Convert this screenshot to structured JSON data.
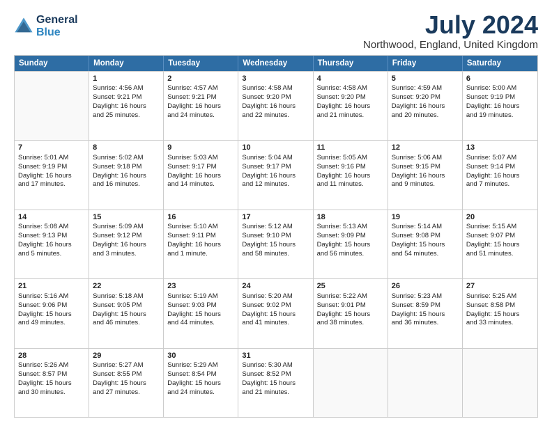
{
  "logo": {
    "line1": "General",
    "line2": "Blue"
  },
  "title": "July 2024",
  "subtitle": "Northwood, England, United Kingdom",
  "days": [
    "Sunday",
    "Monday",
    "Tuesday",
    "Wednesday",
    "Thursday",
    "Friday",
    "Saturday"
  ],
  "weeks": [
    [
      {
        "day": "",
        "sunrise": "",
        "sunset": "",
        "daylight": ""
      },
      {
        "day": "1",
        "sunrise": "Sunrise: 4:56 AM",
        "sunset": "Sunset: 9:21 PM",
        "daylight": "Daylight: 16 hours",
        "daylight2": "and 25 minutes."
      },
      {
        "day": "2",
        "sunrise": "Sunrise: 4:57 AM",
        "sunset": "Sunset: 9:21 PM",
        "daylight": "Daylight: 16 hours",
        "daylight2": "and 24 minutes."
      },
      {
        "day": "3",
        "sunrise": "Sunrise: 4:58 AM",
        "sunset": "Sunset: 9:20 PM",
        "daylight": "Daylight: 16 hours",
        "daylight2": "and 22 minutes."
      },
      {
        "day": "4",
        "sunrise": "Sunrise: 4:58 AM",
        "sunset": "Sunset: 9:20 PM",
        "daylight": "Daylight: 16 hours",
        "daylight2": "and 21 minutes."
      },
      {
        "day": "5",
        "sunrise": "Sunrise: 4:59 AM",
        "sunset": "Sunset: 9:20 PM",
        "daylight": "Daylight: 16 hours",
        "daylight2": "and 20 minutes."
      },
      {
        "day": "6",
        "sunrise": "Sunrise: 5:00 AM",
        "sunset": "Sunset: 9:19 PM",
        "daylight": "Daylight: 16 hours",
        "daylight2": "and 19 minutes."
      }
    ],
    [
      {
        "day": "7",
        "sunrise": "Sunrise: 5:01 AM",
        "sunset": "Sunset: 9:19 PM",
        "daylight": "Daylight: 16 hours",
        "daylight2": "and 17 minutes."
      },
      {
        "day": "8",
        "sunrise": "Sunrise: 5:02 AM",
        "sunset": "Sunset: 9:18 PM",
        "daylight": "Daylight: 16 hours",
        "daylight2": "and 16 minutes."
      },
      {
        "day": "9",
        "sunrise": "Sunrise: 5:03 AM",
        "sunset": "Sunset: 9:17 PM",
        "daylight": "Daylight: 16 hours",
        "daylight2": "and 14 minutes."
      },
      {
        "day": "10",
        "sunrise": "Sunrise: 5:04 AM",
        "sunset": "Sunset: 9:17 PM",
        "daylight": "Daylight: 16 hours",
        "daylight2": "and 12 minutes."
      },
      {
        "day": "11",
        "sunrise": "Sunrise: 5:05 AM",
        "sunset": "Sunset: 9:16 PM",
        "daylight": "Daylight: 16 hours",
        "daylight2": "and 11 minutes."
      },
      {
        "day": "12",
        "sunrise": "Sunrise: 5:06 AM",
        "sunset": "Sunset: 9:15 PM",
        "daylight": "Daylight: 16 hours",
        "daylight2": "and 9 minutes."
      },
      {
        "day": "13",
        "sunrise": "Sunrise: 5:07 AM",
        "sunset": "Sunset: 9:14 PM",
        "daylight": "Daylight: 16 hours",
        "daylight2": "and 7 minutes."
      }
    ],
    [
      {
        "day": "14",
        "sunrise": "Sunrise: 5:08 AM",
        "sunset": "Sunset: 9:13 PM",
        "daylight": "Daylight: 16 hours",
        "daylight2": "and 5 minutes."
      },
      {
        "day": "15",
        "sunrise": "Sunrise: 5:09 AM",
        "sunset": "Sunset: 9:12 PM",
        "daylight": "Daylight: 16 hours",
        "daylight2": "and 3 minutes."
      },
      {
        "day": "16",
        "sunrise": "Sunrise: 5:10 AM",
        "sunset": "Sunset: 9:11 PM",
        "daylight": "Daylight: 16 hours",
        "daylight2": "and 1 minute."
      },
      {
        "day": "17",
        "sunrise": "Sunrise: 5:12 AM",
        "sunset": "Sunset: 9:10 PM",
        "daylight": "Daylight: 15 hours",
        "daylight2": "and 58 minutes."
      },
      {
        "day": "18",
        "sunrise": "Sunrise: 5:13 AM",
        "sunset": "Sunset: 9:09 PM",
        "daylight": "Daylight: 15 hours",
        "daylight2": "and 56 minutes."
      },
      {
        "day": "19",
        "sunrise": "Sunrise: 5:14 AM",
        "sunset": "Sunset: 9:08 PM",
        "daylight": "Daylight: 15 hours",
        "daylight2": "and 54 minutes."
      },
      {
        "day": "20",
        "sunrise": "Sunrise: 5:15 AM",
        "sunset": "Sunset: 9:07 PM",
        "daylight": "Daylight: 15 hours",
        "daylight2": "and 51 minutes."
      }
    ],
    [
      {
        "day": "21",
        "sunrise": "Sunrise: 5:16 AM",
        "sunset": "Sunset: 9:06 PM",
        "daylight": "Daylight: 15 hours",
        "daylight2": "and 49 minutes."
      },
      {
        "day": "22",
        "sunrise": "Sunrise: 5:18 AM",
        "sunset": "Sunset: 9:05 PM",
        "daylight": "Daylight: 15 hours",
        "daylight2": "and 46 minutes."
      },
      {
        "day": "23",
        "sunrise": "Sunrise: 5:19 AM",
        "sunset": "Sunset: 9:03 PM",
        "daylight": "Daylight: 15 hours",
        "daylight2": "and 44 minutes."
      },
      {
        "day": "24",
        "sunrise": "Sunrise: 5:20 AM",
        "sunset": "Sunset: 9:02 PM",
        "daylight": "Daylight: 15 hours",
        "daylight2": "and 41 minutes."
      },
      {
        "day": "25",
        "sunrise": "Sunrise: 5:22 AM",
        "sunset": "Sunset: 9:01 PM",
        "daylight": "Daylight: 15 hours",
        "daylight2": "and 38 minutes."
      },
      {
        "day": "26",
        "sunrise": "Sunrise: 5:23 AM",
        "sunset": "Sunset: 8:59 PM",
        "daylight": "Daylight: 15 hours",
        "daylight2": "and 36 minutes."
      },
      {
        "day": "27",
        "sunrise": "Sunrise: 5:25 AM",
        "sunset": "Sunset: 8:58 PM",
        "daylight": "Daylight: 15 hours",
        "daylight2": "and 33 minutes."
      }
    ],
    [
      {
        "day": "28",
        "sunrise": "Sunrise: 5:26 AM",
        "sunset": "Sunset: 8:57 PM",
        "daylight": "Daylight: 15 hours",
        "daylight2": "and 30 minutes."
      },
      {
        "day": "29",
        "sunrise": "Sunrise: 5:27 AM",
        "sunset": "Sunset: 8:55 PM",
        "daylight": "Daylight: 15 hours",
        "daylight2": "and 27 minutes."
      },
      {
        "day": "30",
        "sunrise": "Sunrise: 5:29 AM",
        "sunset": "Sunset: 8:54 PM",
        "daylight": "Daylight: 15 hours",
        "daylight2": "and 24 minutes."
      },
      {
        "day": "31",
        "sunrise": "Sunrise: 5:30 AM",
        "sunset": "Sunset: 8:52 PM",
        "daylight": "Daylight: 15 hours",
        "daylight2": "and 21 minutes."
      },
      {
        "day": "",
        "sunrise": "",
        "sunset": "",
        "daylight": "",
        "daylight2": ""
      },
      {
        "day": "",
        "sunrise": "",
        "sunset": "",
        "daylight": "",
        "daylight2": ""
      },
      {
        "day": "",
        "sunrise": "",
        "sunset": "",
        "daylight": "",
        "daylight2": ""
      }
    ]
  ]
}
